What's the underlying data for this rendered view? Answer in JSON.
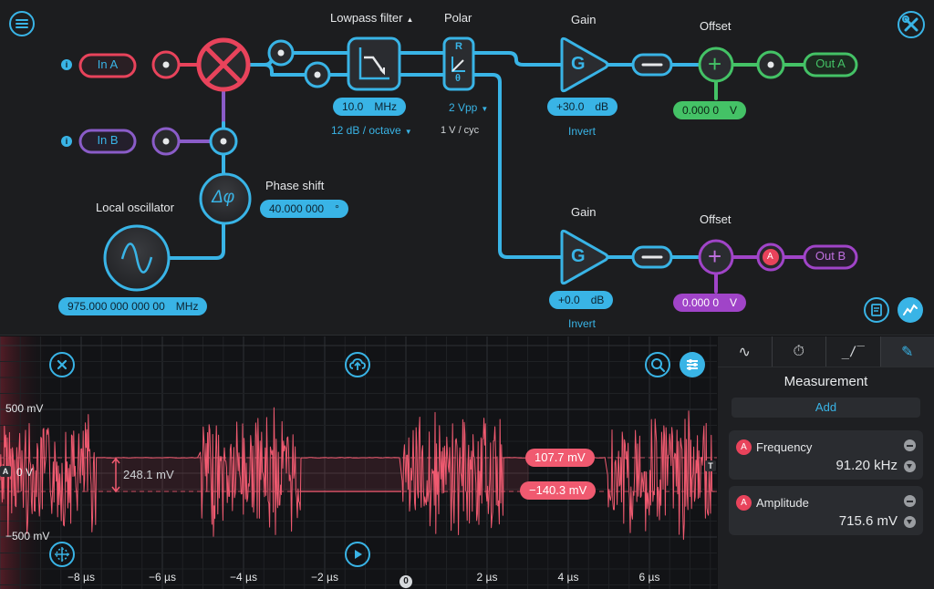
{
  "blocks": {
    "lowpass_title": "Lowpass filter",
    "polar_title": "Polar",
    "gain_title_a": "Gain",
    "gain_title_b": "Gain",
    "offset_title_a": "Offset",
    "offset_title_b": "Offset",
    "phase_title": "Phase shift",
    "osc_title": "Local oscillator"
  },
  "inputs": {
    "in_a": "In A",
    "in_b": "In B"
  },
  "outputs": {
    "out_a": "Out A",
    "out_b": "Out B"
  },
  "filter": {
    "value": "10.0",
    "unit": "MHz",
    "slope": "12 dB / octave"
  },
  "polar": {
    "range": "2 Vpp",
    "scale": "1 V / cyc",
    "r": "R",
    "theta": "θ"
  },
  "gain_a": {
    "value": "+30.0",
    "unit": "dB",
    "invert": "Invert"
  },
  "gain_b": {
    "value": "+0.0",
    "unit": "dB",
    "invert": "Invert"
  },
  "offset_a": {
    "value": "0.000 0",
    "unit": "V"
  },
  "offset_b": {
    "value": "0.000 0",
    "unit": "V"
  },
  "phase": {
    "value": "40.000 000",
    "unit": "°"
  },
  "oscillator": {
    "value": "975.000 000 000 00",
    "unit": "MHz"
  },
  "symbols": {
    "g": "G",
    "dphi": "Δφ",
    "plus": "+",
    "a": "A",
    "info": "i"
  },
  "scope": {
    "y_labels": [
      "500 mV",
      "0 V",
      "−500 mV"
    ],
    "x_labels": [
      "−8 µs",
      "−6 µs",
      "−4 µs",
      "−2 µs",
      "0",
      "2 µs",
      "4 µs",
      "6 µs"
    ],
    "delta_label": "248.1 mV",
    "cursor_upper": "107.7 mV",
    "cursor_lower": "−140.3 mV",
    "channel_marker": "A",
    "trigger_marker": "T"
  },
  "panel": {
    "title": "Measurement",
    "add": "Add",
    "items": [
      {
        "channel": "A",
        "name": "Frequency",
        "value": "91.20 kHz"
      },
      {
        "channel": "A",
        "name": "Amplitude",
        "value": "715.6 mV"
      }
    ]
  },
  "colors": {
    "accent": "#39b4e6",
    "in_a": "#e8435b",
    "in_b": "#8a5cc8",
    "out_a": "#44c266",
    "out_b": "#a044c8",
    "trace": "#f05a70"
  }
}
